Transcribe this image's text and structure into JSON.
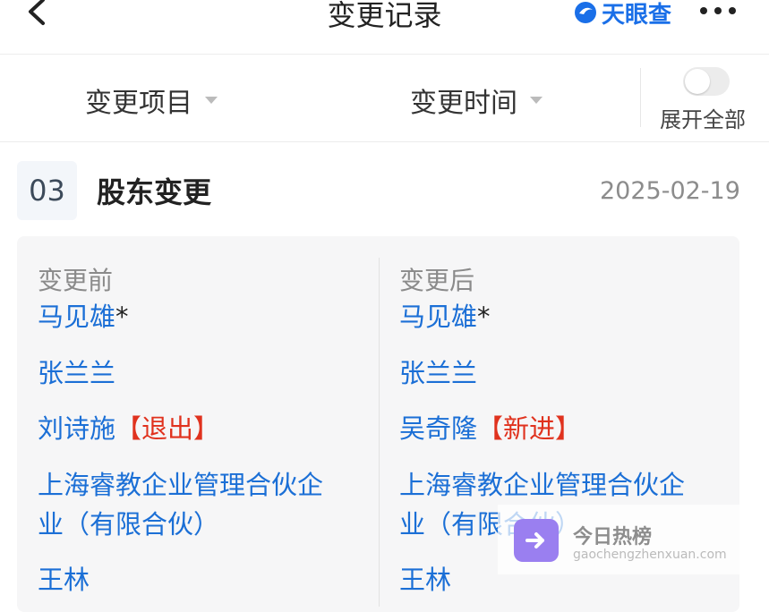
{
  "nav": {
    "title": "变更记录",
    "logo_text": "天眼查",
    "back_icon": "chevron-left-icon",
    "more_icon": "more-dots-icon"
  },
  "filters": {
    "item_label": "变更项目",
    "time_label": "变更时间",
    "toggle_label": "展开全部",
    "toggle_on": false
  },
  "record": {
    "number": "03",
    "title": "股东变更",
    "date": "2025-02-19",
    "before": {
      "heading": "变更前",
      "items": [
        {
          "name": "马见雄",
          "suffix": "*"
        },
        {
          "name": "张兰兰"
        },
        {
          "name": "刘诗施",
          "tag": "【退出】"
        },
        {
          "name_line1": "上海睿教企业管理合伙企",
          "name_line2": "业（有限合伙）"
        },
        {
          "name": "王林"
        }
      ]
    },
    "after": {
      "heading": "变更后",
      "items": [
        {
          "name": "马见雄",
          "suffix": "*"
        },
        {
          "name": "张兰兰"
        },
        {
          "name": "吴奇隆",
          "tag": "【新进】"
        },
        {
          "name_line1": "上海睿教企业管理合伙企",
          "name_line2": "业（有限合伙）"
        },
        {
          "name": "王林"
        }
      ]
    }
  },
  "watermark": {
    "title": "今日热榜",
    "url": "gaochengzhenxuan.com"
  },
  "colors": {
    "link": "#1b6fd6",
    "tag": "#e0321e",
    "brand": "#1a6fe8"
  }
}
